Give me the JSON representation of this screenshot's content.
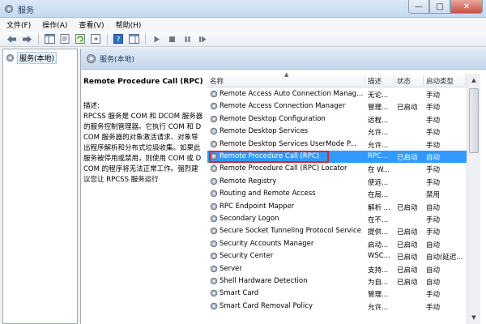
{
  "window": {
    "title": "服务",
    "min": "—",
    "max": "□",
    "close": "✕"
  },
  "menu": [
    "文件(F)",
    "操作(A)",
    "查看(V)",
    "帮助(H)"
  ],
  "tree": {
    "root": "服务(本地)"
  },
  "panel": {
    "header": "服务(本地)",
    "service_name": "Remote Procedure Call (RPC)",
    "desc_label": "描述:",
    "desc_text": "RPCSS 服务是 COM 和 DCOM 服务器的服务控制管理器。它执行 COM 和 DCOM 服务器的对象激活请求、对象导出程序解析和分布式垃圾收集。如果此服务被停用或禁用，则使用 COM 或 DCOM 的程序将无法正常工作。强烈建议您让 RPCSS 服务运行"
  },
  "columns": {
    "name": "名称",
    "desc": "描述",
    "status": "状态",
    "start": "启动类型",
    "sort_indicator": "▲"
  },
  "selected_index": 6,
  "rows": [
    {
      "name": "Remote Access Auto Connection Manag...",
      "desc": "无论...",
      "status": "",
      "start": "手动"
    },
    {
      "name": "Remote Access Connection Manager",
      "desc": "管理...",
      "status": "已启动",
      "start": "手动"
    },
    {
      "name": "Remote Desktop Configuration",
      "desc": "远程...",
      "status": "",
      "start": "手动"
    },
    {
      "name": "Remote Desktop Services",
      "desc": "允许...",
      "status": "",
      "start": "手动"
    },
    {
      "name": "Remote Desktop Services UserMode P...",
      "desc": "允许...",
      "status": "",
      "start": "手动"
    },
    {
      "name": "Remote Procedure Call (RPC)",
      "desc": "RPC...",
      "status": "已启动",
      "start": "自动"
    },
    {
      "name": "Remote Procedure Call (RPC) Locator",
      "desc": "在 W...",
      "status": "",
      "start": "手动"
    },
    {
      "name": "Remote Registry",
      "desc": "使远...",
      "status": "",
      "start": "手动"
    },
    {
      "name": "Routing and Remote Access",
      "desc": "在局...",
      "status": "",
      "start": "禁用"
    },
    {
      "name": "RPC Endpoint Mapper",
      "desc": "解析 ...",
      "status": "已启动",
      "start": "自动"
    },
    {
      "name": "Secondary Logon",
      "desc": "在不...",
      "status": "",
      "start": "手动"
    },
    {
      "name": "Secure Socket Tunneling Protocol Service",
      "desc": "提供...",
      "status": "已启动",
      "start": "手动"
    },
    {
      "name": "Security Accounts Manager",
      "desc": "启动...",
      "status": "已启动",
      "start": "自动"
    },
    {
      "name": "Security Center",
      "desc": "WSC...",
      "status": "已启动",
      "start": "自动(延迟..."
    },
    {
      "name": "Server",
      "desc": "支持...",
      "status": "已启动",
      "start": "自动"
    },
    {
      "name": "Shell Hardware Detection",
      "desc": "为自...",
      "status": "已启动",
      "start": "自动"
    },
    {
      "name": "Smart Card",
      "desc": "管理...",
      "status": "",
      "start": "手动"
    },
    {
      "name": "Smart Card Removal Policy",
      "desc": "允许...",
      "status": "",
      "start": "手动"
    }
  ],
  "scroll": {
    "up": "▲",
    "down": "▼"
  }
}
